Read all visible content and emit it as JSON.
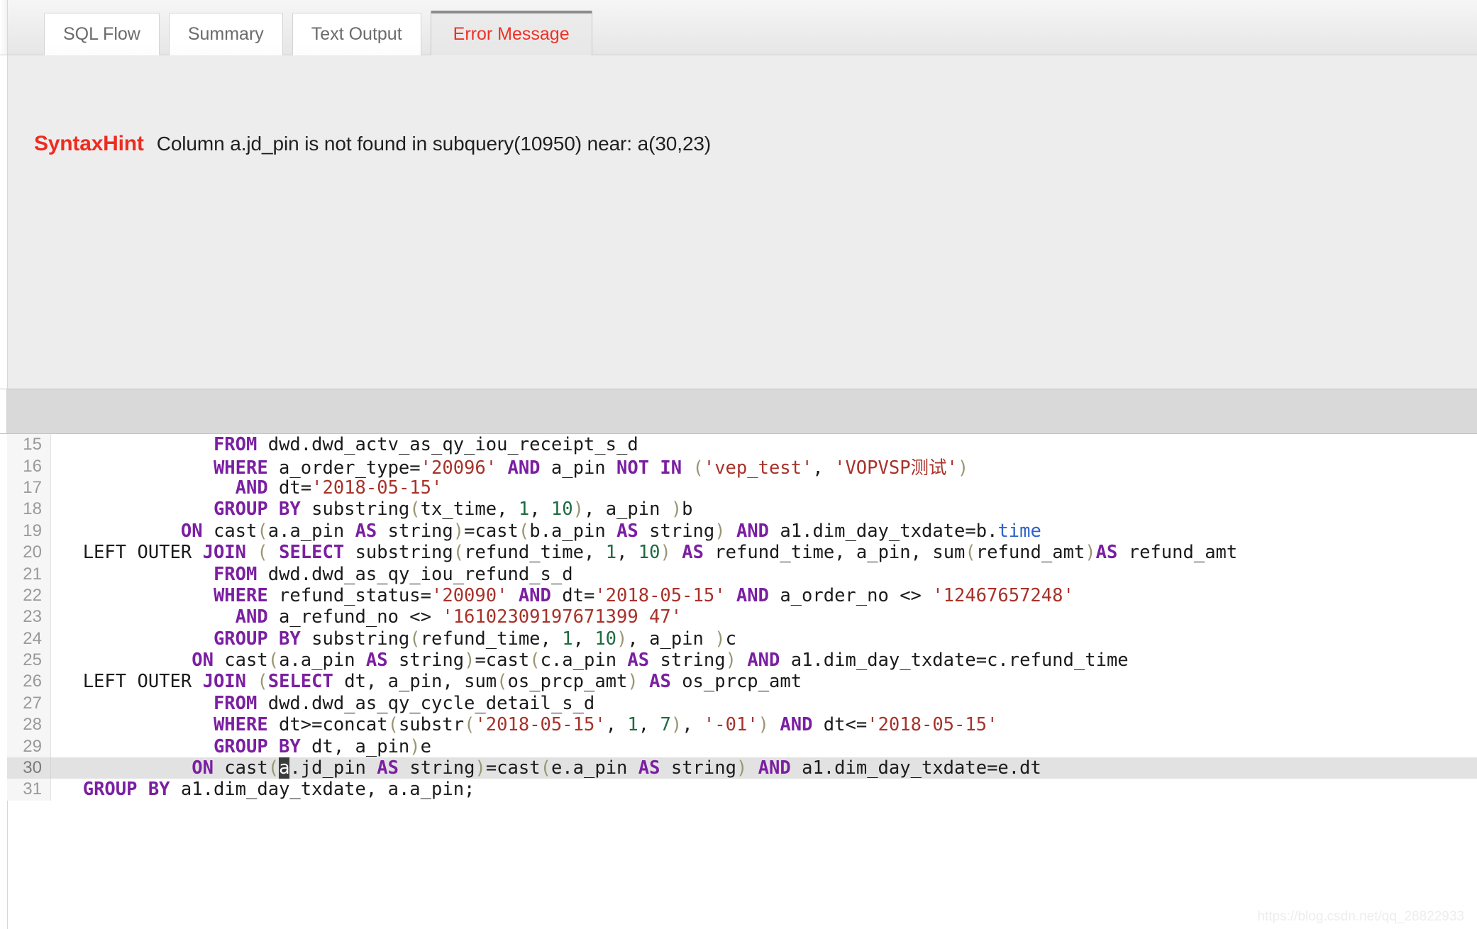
{
  "tabs": [
    {
      "id": "sql-flow",
      "label": "SQL Flow",
      "active": false
    },
    {
      "id": "summary",
      "label": "Summary",
      "active": false
    },
    {
      "id": "text-output",
      "label": "Text Output",
      "active": false
    },
    {
      "id": "error-message",
      "label": "Error Message",
      "active": true
    }
  ],
  "error_panel": {
    "hint_label": "SyntaxHint",
    "message": "Column a.jd_pin is not found in subquery(10950) near: a(30,23)"
  },
  "colors": {
    "error_red": "#ee2b1f",
    "keyword_purple": "#7b1fa2",
    "string_red": "#a8322a",
    "number_green": "#1d6b3f",
    "paren_olive": "#9a9673",
    "field_blue": "#2f62c8",
    "current_line_bg": "#e2e2e2",
    "selection_bg": "#3b3b3b"
  },
  "editor": {
    "current_line": 30,
    "first_visible_line": 15,
    "last_visible_line": 31,
    "lines": [
      {
        "number": "15",
        "plain": "              FROM dwd.dwd_actv_as_qy_iou_receipt_s_d",
        "tokens": [
          {
            "t": "              ",
            "c": "plain"
          },
          {
            "t": "FROM",
            "c": "kw"
          },
          {
            "t": " dwd.dwd_actv_as_qy_iou_receipt_s_d",
            "c": "plain"
          }
        ]
      },
      {
        "number": "16",
        "plain": "              WHERE a_order_type='20096' AND a_pin NOT IN ('vep_test', 'VOPVSP测试')",
        "tokens": [
          {
            "t": "              ",
            "c": "plain"
          },
          {
            "t": "WHERE",
            "c": "kw"
          },
          {
            "t": " a_order_type=",
            "c": "plain"
          },
          {
            "t": "'20096'",
            "c": "str"
          },
          {
            "t": " ",
            "c": "plain"
          },
          {
            "t": "AND",
            "c": "kw"
          },
          {
            "t": " a_pin ",
            "c": "plain"
          },
          {
            "t": "NOT IN",
            "c": "kw"
          },
          {
            "t": " ",
            "c": "plain"
          },
          {
            "t": "(",
            "c": "par"
          },
          {
            "t": "'vep_test'",
            "c": "str"
          },
          {
            "t": ", ",
            "c": "plain"
          },
          {
            "t": "'VOPVSP测试'",
            "c": "str"
          },
          {
            "t": ")",
            "c": "par"
          }
        ]
      },
      {
        "number": "17",
        "plain": "                AND dt='2018-05-15'",
        "tokens": [
          {
            "t": "                ",
            "c": "plain"
          },
          {
            "t": "AND",
            "c": "kw"
          },
          {
            "t": " dt=",
            "c": "plain"
          },
          {
            "t": "'2018-05-15'",
            "c": "str"
          }
        ]
      },
      {
        "number": "18",
        "plain": "              GROUP BY substring(tx_time, 1, 10), a_pin )b",
        "tokens": [
          {
            "t": "              ",
            "c": "plain"
          },
          {
            "t": "GROUP BY",
            "c": "kw"
          },
          {
            "t": " substring",
            "c": "plain"
          },
          {
            "t": "(",
            "c": "par"
          },
          {
            "t": "tx_time, ",
            "c": "plain"
          },
          {
            "t": "1",
            "c": "num"
          },
          {
            "t": ", ",
            "c": "plain"
          },
          {
            "t": "10",
            "c": "num"
          },
          {
            "t": ")",
            "c": "par"
          },
          {
            "t": ", a_pin ",
            "c": "plain"
          },
          {
            "t": ")",
            "c": "par"
          },
          {
            "t": "b",
            "c": "plain"
          }
        ]
      },
      {
        "number": "19",
        "plain": "           ON cast(a.a_pin AS string)=cast(b.a_pin AS string) AND a1.dim_day_txdate=b.time",
        "tokens": [
          {
            "t": "           ",
            "c": "plain"
          },
          {
            "t": "ON",
            "c": "kw"
          },
          {
            "t": " cast",
            "c": "plain"
          },
          {
            "t": "(",
            "c": "par"
          },
          {
            "t": "a.a_pin ",
            "c": "plain"
          },
          {
            "t": "AS",
            "c": "kw"
          },
          {
            "t": " string",
            "c": "plain"
          },
          {
            "t": ")",
            "c": "par"
          },
          {
            "t": "=cast",
            "c": "plain"
          },
          {
            "t": "(",
            "c": "par"
          },
          {
            "t": "b.a_pin ",
            "c": "plain"
          },
          {
            "t": "AS",
            "c": "kw"
          },
          {
            "t": " string",
            "c": "plain"
          },
          {
            "t": ")",
            "c": "par"
          },
          {
            "t": " ",
            "c": "plain"
          },
          {
            "t": "AND",
            "c": "kw"
          },
          {
            "t": " a1.dim_day_txdate=b.",
            "c": "plain"
          },
          {
            "t": "time",
            "c": "fld"
          }
        ]
      },
      {
        "number": "20",
        "plain": "  LEFT OUTER JOIN ( SELECT substring(refund_time, 1, 10) AS refund_time, a_pin, sum(refund_amt)AS refund_amt",
        "tokens": [
          {
            "t": "  LEFT OUTER ",
            "c": "plain"
          },
          {
            "t": "JOIN",
            "c": "kw"
          },
          {
            "t": " ",
            "c": "plain"
          },
          {
            "t": "(",
            "c": "par"
          },
          {
            "t": " ",
            "c": "plain"
          },
          {
            "t": "SELECT",
            "c": "kw"
          },
          {
            "t": " substring",
            "c": "plain"
          },
          {
            "t": "(",
            "c": "par"
          },
          {
            "t": "refund_time, ",
            "c": "plain"
          },
          {
            "t": "1",
            "c": "num"
          },
          {
            "t": ", ",
            "c": "plain"
          },
          {
            "t": "10",
            "c": "num"
          },
          {
            "t": ")",
            "c": "par"
          },
          {
            "t": " ",
            "c": "plain"
          },
          {
            "t": "AS",
            "c": "kw"
          },
          {
            "t": " refund_time, a_pin, sum",
            "c": "plain"
          },
          {
            "t": "(",
            "c": "par"
          },
          {
            "t": "refund_amt",
            "c": "plain"
          },
          {
            "t": ")",
            "c": "par"
          },
          {
            "t": "AS",
            "c": "kw"
          },
          {
            "t": " refund_amt",
            "c": "plain"
          }
        ]
      },
      {
        "number": "21",
        "plain": "              FROM dwd.dwd_as_qy_iou_refund_s_d",
        "tokens": [
          {
            "t": "              ",
            "c": "plain"
          },
          {
            "t": "FROM",
            "c": "kw"
          },
          {
            "t": " dwd.dwd_as_qy_iou_refund_s_d",
            "c": "plain"
          }
        ]
      },
      {
        "number": "22",
        "plain": "              WHERE refund_status='20090' AND dt='2018-05-15' AND a_order_no <> '12467657248'",
        "tokens": [
          {
            "t": "              ",
            "c": "plain"
          },
          {
            "t": "WHERE",
            "c": "kw"
          },
          {
            "t": " refund_status=",
            "c": "plain"
          },
          {
            "t": "'20090'",
            "c": "str"
          },
          {
            "t": " ",
            "c": "plain"
          },
          {
            "t": "AND",
            "c": "kw"
          },
          {
            "t": " dt=",
            "c": "plain"
          },
          {
            "t": "'2018-05-15'",
            "c": "str"
          },
          {
            "t": " ",
            "c": "plain"
          },
          {
            "t": "AND",
            "c": "kw"
          },
          {
            "t": " a_order_no <> ",
            "c": "plain"
          },
          {
            "t": "'12467657248'",
            "c": "str"
          }
        ]
      },
      {
        "number": "23",
        "plain": "                AND a_refund_no <> '16102309197671399 47'",
        "tokens": [
          {
            "t": "                ",
            "c": "plain"
          },
          {
            "t": "AND",
            "c": "kw"
          },
          {
            "t": " a_refund_no <> ",
            "c": "plain"
          },
          {
            "t": "'16102309197671399 47'",
            "c": "str"
          }
        ]
      },
      {
        "number": "24",
        "plain": "              GROUP BY substring(refund_time, 1, 10), a_pin )c",
        "tokens": [
          {
            "t": "              ",
            "c": "plain"
          },
          {
            "t": "GROUP BY",
            "c": "kw"
          },
          {
            "t": " substring",
            "c": "plain"
          },
          {
            "t": "(",
            "c": "par"
          },
          {
            "t": "refund_time, ",
            "c": "plain"
          },
          {
            "t": "1",
            "c": "num"
          },
          {
            "t": ", ",
            "c": "plain"
          },
          {
            "t": "10",
            "c": "num"
          },
          {
            "t": ")",
            "c": "par"
          },
          {
            "t": ", a_pin ",
            "c": "plain"
          },
          {
            "t": ")",
            "c": "par"
          },
          {
            "t": "c",
            "c": "plain"
          }
        ]
      },
      {
        "number": "25",
        "plain": "            ON cast(a.a_pin AS string)=cast(c.a_pin AS string) AND a1.dim_day_txdate=c.refund_time",
        "tokens": [
          {
            "t": "            ",
            "c": "plain"
          },
          {
            "t": "ON",
            "c": "kw"
          },
          {
            "t": " cast",
            "c": "plain"
          },
          {
            "t": "(",
            "c": "par"
          },
          {
            "t": "a.a_pin ",
            "c": "plain"
          },
          {
            "t": "AS",
            "c": "kw"
          },
          {
            "t": " string",
            "c": "plain"
          },
          {
            "t": ")",
            "c": "par"
          },
          {
            "t": "=cast",
            "c": "plain"
          },
          {
            "t": "(",
            "c": "par"
          },
          {
            "t": "c.a_pin ",
            "c": "plain"
          },
          {
            "t": "AS",
            "c": "kw"
          },
          {
            "t": " string",
            "c": "plain"
          },
          {
            "t": ")",
            "c": "par"
          },
          {
            "t": " ",
            "c": "plain"
          },
          {
            "t": "AND",
            "c": "kw"
          },
          {
            "t": " a1.dim_day_txdate=c.refund_time",
            "c": "plain"
          }
        ]
      },
      {
        "number": "26",
        "plain": "  LEFT OUTER JOIN (SELECT dt, a_pin, sum(os_prcp_amt) AS os_prcp_amt",
        "tokens": [
          {
            "t": "  LEFT OUTER ",
            "c": "plain"
          },
          {
            "t": "JOIN",
            "c": "kw"
          },
          {
            "t": " ",
            "c": "plain"
          },
          {
            "t": "(",
            "c": "par"
          },
          {
            "t": "SELECT",
            "c": "kw"
          },
          {
            "t": " dt, a_pin, sum",
            "c": "plain"
          },
          {
            "t": "(",
            "c": "par"
          },
          {
            "t": "os_prcp_amt",
            "c": "plain"
          },
          {
            "t": ")",
            "c": "par"
          },
          {
            "t": " ",
            "c": "plain"
          },
          {
            "t": "AS",
            "c": "kw"
          },
          {
            "t": " os_prcp_amt",
            "c": "plain"
          }
        ]
      },
      {
        "number": "27",
        "plain": "              FROM dwd.dwd_as_qy_cycle_detail_s_d",
        "tokens": [
          {
            "t": "              ",
            "c": "plain"
          },
          {
            "t": "FROM",
            "c": "kw"
          },
          {
            "t": " dwd.dwd_as_qy_cycle_detail_s_d",
            "c": "plain"
          }
        ]
      },
      {
        "number": "28",
        "plain": "              WHERE dt>=concat(substr('2018-05-15', 1, 7), '-01') AND dt<='2018-05-15'",
        "tokens": [
          {
            "t": "              ",
            "c": "plain"
          },
          {
            "t": "WHERE",
            "c": "kw"
          },
          {
            "t": " dt>=concat",
            "c": "plain"
          },
          {
            "t": "(",
            "c": "par"
          },
          {
            "t": "substr",
            "c": "plain"
          },
          {
            "t": "(",
            "c": "par"
          },
          {
            "t": "'2018-05-15'",
            "c": "str"
          },
          {
            "t": ", ",
            "c": "plain"
          },
          {
            "t": "1",
            "c": "num"
          },
          {
            "t": ", ",
            "c": "plain"
          },
          {
            "t": "7",
            "c": "num"
          },
          {
            "t": ")",
            "c": "par"
          },
          {
            "t": ", ",
            "c": "plain"
          },
          {
            "t": "'-01'",
            "c": "str"
          },
          {
            "t": ")",
            "c": "par"
          },
          {
            "t": " ",
            "c": "plain"
          },
          {
            "t": "AND",
            "c": "kw"
          },
          {
            "t": " dt<=",
            "c": "plain"
          },
          {
            "t": "'2018-05-15'",
            "c": "str"
          }
        ]
      },
      {
        "number": "29",
        "plain": "              GROUP BY dt, a_pin)e",
        "tokens": [
          {
            "t": "              ",
            "c": "plain"
          },
          {
            "t": "GROUP BY",
            "c": "kw"
          },
          {
            "t": " dt, a_pin",
            "c": "plain"
          },
          {
            "t": ")",
            "c": "par"
          },
          {
            "t": "e",
            "c": "plain"
          }
        ]
      },
      {
        "number": "30",
        "current": true,
        "plain": "            ON cast(a.jd_pin AS string)=cast(e.a_pin AS string) AND a1.dim_day_txdate=e.dt",
        "tokens": [
          {
            "t": "            ",
            "c": "plain"
          },
          {
            "t": "ON",
            "c": "kw"
          },
          {
            "t": " cast",
            "c": "plain"
          },
          {
            "t": "(",
            "c": "par"
          },
          {
            "t": "a",
            "c": "sel"
          },
          {
            "t": ".jd_pin ",
            "c": "plain"
          },
          {
            "t": "AS",
            "c": "kw"
          },
          {
            "t": " string",
            "c": "plain"
          },
          {
            "t": ")",
            "c": "par"
          },
          {
            "t": "=cast",
            "c": "plain"
          },
          {
            "t": "(",
            "c": "par"
          },
          {
            "t": "e.a_pin ",
            "c": "plain"
          },
          {
            "t": "AS",
            "c": "kw"
          },
          {
            "t": " string",
            "c": "plain"
          },
          {
            "t": ")",
            "c": "par"
          },
          {
            "t": " ",
            "c": "plain"
          },
          {
            "t": "AND",
            "c": "kw"
          },
          {
            "t": " a1.dim_day_txdate=e.dt",
            "c": "plain"
          }
        ]
      },
      {
        "number": "31",
        "plain": "  GROUP BY a1.dim_day_txdate, a.a_pin;",
        "tokens": [
          {
            "t": "  ",
            "c": "plain"
          },
          {
            "t": "GROUP BY",
            "c": "kw"
          },
          {
            "t": " a1.dim_day_txdate, a.a_pin;",
            "c": "plain"
          }
        ]
      }
    ]
  },
  "watermark": "https://blog.csdn.net/qq_28822933"
}
